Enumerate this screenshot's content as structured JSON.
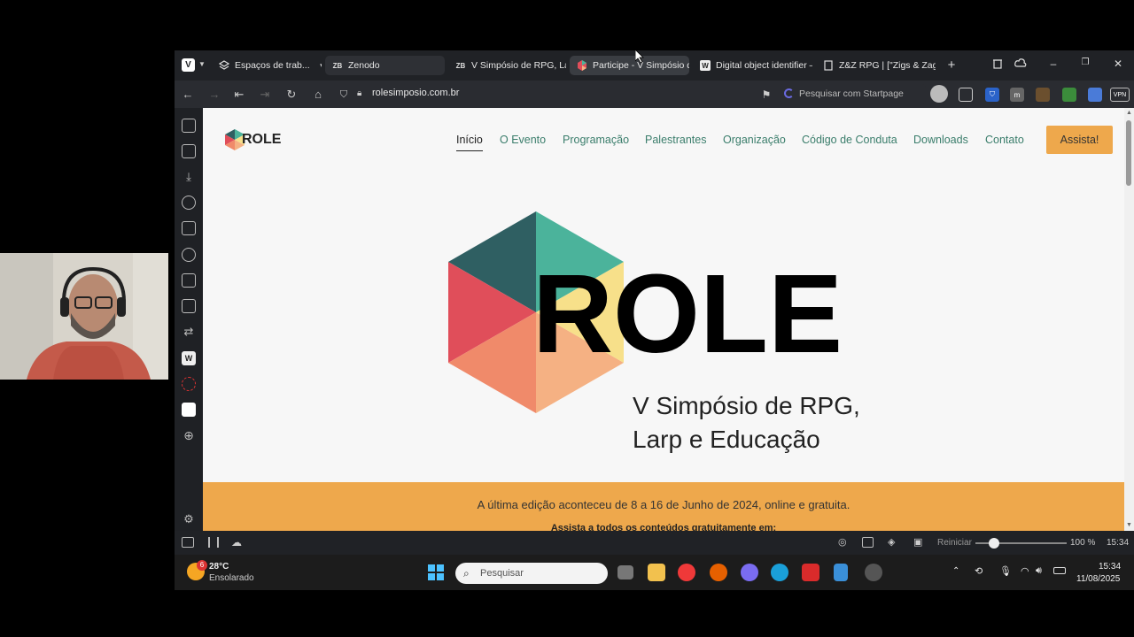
{
  "browser": {
    "tabs": [
      {
        "label": "Espaços de trab...",
        "icon": "workspaces-icon"
      },
      {
        "label": "Zenodo",
        "icon": "zenodo-icon",
        "badge": "ZB"
      },
      {
        "label": "V Simpósio de RPG, Larp e",
        "icon": "zenodo-icon",
        "badge": "ZB"
      },
      {
        "label": "Participe - V Simpósio de",
        "icon": "role-favicon"
      },
      {
        "label": "Digital object identifier – W",
        "icon": "wikipedia-icon",
        "badge": "W"
      },
      {
        "label": "Z&Z RPG | [\"Zigs & Zags\"]",
        "icon": "page-icon"
      }
    ],
    "url": "rolesimposio.com.br",
    "search_placeholder": "Pesquisar com Startpage",
    "vpn_label": "VPN",
    "status": {
      "reset_label": "Reiniciar",
      "zoom": "100 %",
      "time": "15:34"
    }
  },
  "site": {
    "logo_text": "ROLE",
    "nav": [
      {
        "label": "Início",
        "active": true
      },
      {
        "label": "O Evento"
      },
      {
        "label": "Programação"
      },
      {
        "label": "Palestrantes"
      },
      {
        "label": "Organização"
      },
      {
        "label": "Código de Conduta"
      },
      {
        "label": "Downloads"
      },
      {
        "label": "Contato"
      }
    ],
    "cta_label": "Assista!",
    "hero_word": "ROLE",
    "hero_subtitle_line1": "V Simpósio de RPG,",
    "hero_subtitle_line2": "Larp e Educação",
    "banner_line1": "A última edição aconteceu de 8 a 16 de Junho de 2024, online e gratuita.",
    "banner_line2": "Assista a todos os conteúdos gratuitamente em:"
  },
  "taskbar": {
    "weather_temp": "28°C",
    "weather_desc": "Ensolarado",
    "weather_badge": "6",
    "search_placeholder": "Pesquisar",
    "clock_time": "15:34",
    "clock_date": "11/08/2025"
  },
  "colors": {
    "accent_orange": "#eea84c",
    "nav_green": "#3a7d6b",
    "hex_teal": "#4bb39b",
    "hex_darkteal": "#2f5f62",
    "hex_red": "#e04e5a",
    "hex_coral": "#f08a6a",
    "hex_peach": "#f5b183",
    "hex_yellow": "#f7e08a"
  }
}
